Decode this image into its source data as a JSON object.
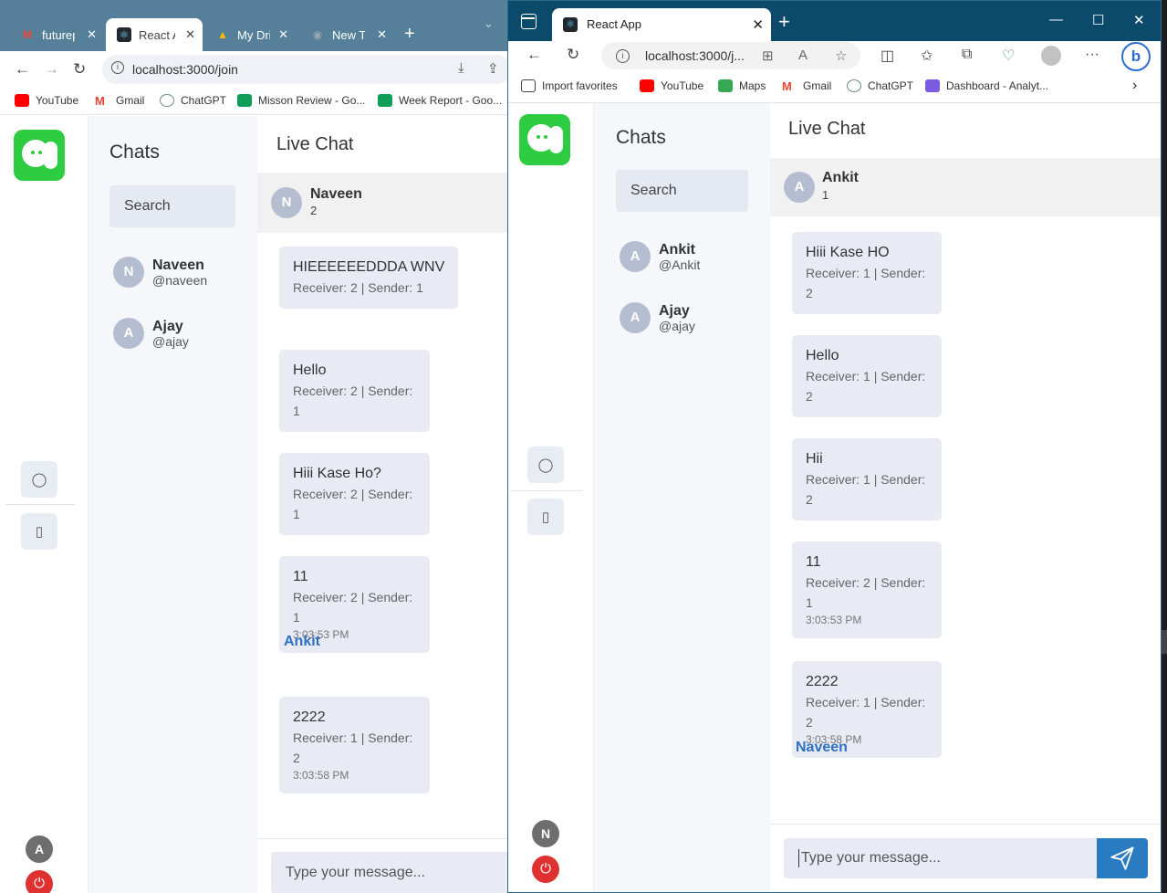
{
  "window_a": {
    "tabs": [
      {
        "label": "futurep"
      },
      {
        "label": "React A"
      },
      {
        "label": "My Driv"
      },
      {
        "label": "New Ta"
      }
    ],
    "url": "localhost:3000/join",
    "bookmarks": [
      "YouTube",
      "Gmail",
      "ChatGPT",
      "Misson Review - Go...",
      "Week Report - Goo..."
    ],
    "app": {
      "sidebar_title": "Chats",
      "search_placeholder": "Search",
      "contacts": [
        {
          "initial": "N",
          "name": "Naveen",
          "handle": "@naveen"
        },
        {
          "initial": "A",
          "name": "Ajay",
          "handle": "@ajay"
        }
      ],
      "main_title": "Live Chat",
      "chat_header": {
        "initial": "N",
        "name": "Naveen",
        "count": "2"
      },
      "messages": [
        {
          "text": "HIEEEEEEDDDA WNV",
          "meta": "Receiver: 2 | Sender: 1",
          "time": ""
        },
        {
          "text": "Hello",
          "meta": "Receiver: 2 | Sender: 1",
          "time": ""
        },
        {
          "text": "Hiii Kase Ho?",
          "meta": "Receiver: 2 | Sender: 1",
          "time": ""
        },
        {
          "text": "11",
          "meta": "Receiver: 2 | Sender: 1",
          "time": "3:03:53 PM"
        },
        {
          "text": "2222",
          "meta": "Receiver: 1 | Sender: 2",
          "time": "3:03:58 PM"
        }
      ],
      "sender_label": "Ankit",
      "composer_placeholder": "Type your message...",
      "user_initial": "A"
    }
  },
  "window_b": {
    "tab_title": "React App",
    "url": "localhost:3000/j...",
    "bookmarks": [
      "Import favorites",
      "YouTube",
      "Maps",
      "Gmail",
      "ChatGPT",
      "Dashboard - Analyt..."
    ],
    "app": {
      "sidebar_title": "Chats",
      "search_placeholder": "Search",
      "contacts": [
        {
          "initial": "A",
          "name": "Ankit",
          "handle": "@Ankit"
        },
        {
          "initial": "A",
          "name": "Ajay",
          "handle": "@ajay"
        }
      ],
      "main_title": "Live Chat",
      "chat_header": {
        "initial": "A",
        "name": "Ankit",
        "count": "1"
      },
      "messages": [
        {
          "text": "Hiii Kase HO",
          "meta": "Receiver: 1 | Sender: 2",
          "time": ""
        },
        {
          "text": "Hello",
          "meta": "Receiver: 1 | Sender: 2",
          "time": ""
        },
        {
          "text": "Hii",
          "meta": "Receiver: 1 | Sender: 2",
          "time": ""
        },
        {
          "text": "11",
          "meta": "Receiver: 2 | Sender: 1",
          "time": "3:03:53 PM"
        },
        {
          "text": "2222",
          "meta": "Receiver: 1 | Sender: 2",
          "time": "3:03:58 PM"
        }
      ],
      "sender_label": "Naveen",
      "composer_placeholder": "Type your message...",
      "user_initial": "N"
    }
  },
  "colors": {
    "brand_green": "#2ecc40",
    "accent_blue": "#2b7bc1",
    "chrome_frame": "#56809a",
    "edge_frame": "#0c4a6b",
    "logout_red": "#e03131"
  },
  "icons": {
    "chat": "chat-bubble-icon",
    "files": "file-icon",
    "logout": "power-icon",
    "send": "paper-plane-icon"
  }
}
